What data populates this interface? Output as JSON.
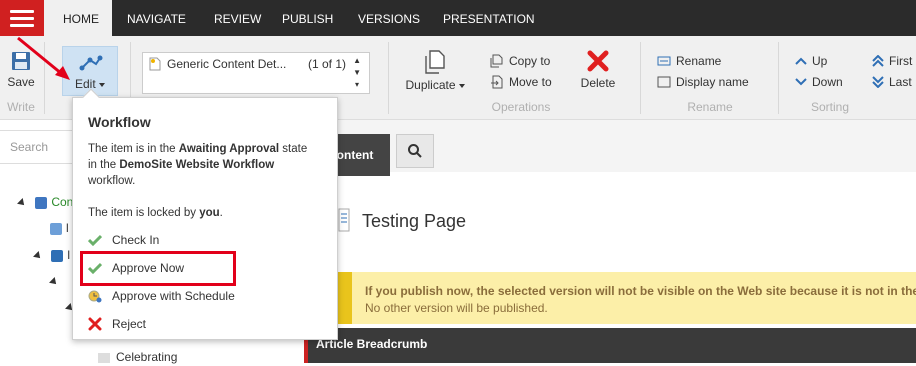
{
  "tabs": [
    "HOME",
    "NAVIGATE",
    "REVIEW",
    "PUBLISH",
    "VERSIONS",
    "PRESENTATION"
  ],
  "ribbon": {
    "save_label": "Save",
    "write_group": "Write",
    "edit_label": "Edit",
    "item_selector_text": "Generic Content Det...",
    "item_selector_count": "(1 of 1)",
    "duplicate_label": "Duplicate",
    "copy_to_label": "Copy to",
    "move_to_label": "Move to",
    "delete_label": "Delete",
    "operations_group": "Operations",
    "rename_label": "Rename",
    "display_name_label": "Display name",
    "rename_group": "Rename",
    "up_label": "Up",
    "down_label": "Down",
    "first_label": "First",
    "last_label": "Last",
    "sorting_group": "Sorting"
  },
  "left_panel": {
    "search_placeholder": "Search",
    "tree_items": [
      "Con",
      "l",
      "l",
      "Celebrating"
    ]
  },
  "content": {
    "tab_label": "Content",
    "page_title": "Testing Page",
    "warning_line1": "If you publish now, the selected version will not be visible on the Web site because it is not in the",
    "warning_line2": "No other version will be published.",
    "breadcrumb_label": "Article Breadcrumb"
  },
  "workflow": {
    "title": "Workflow",
    "state_line1_a": "The item is in the ",
    "state_line1_b": "Awaiting Approval",
    "state_line1_c": " state",
    "state_line2_a": "in the ",
    "state_line2_b": "DemoSite Website Workflow",
    "state_line3": "workflow.",
    "locked_a": "The item is locked by ",
    "locked_b": "you",
    "locked_c": ".",
    "items": [
      "Check In",
      "Approve Now",
      "Approve with Schedule",
      "Reject"
    ]
  },
  "colors": {
    "accent_red": "#d02020",
    "tab_bar": "#2b2b2b",
    "highlight": "#e2001a",
    "warning_bg": "#fcefa8",
    "check_green": "#5cb85c"
  },
  "icons": [
    "hamburger-icon",
    "save-icon",
    "edit-workflow-icon",
    "document-icon",
    "duplicate-icon",
    "copy-icon",
    "move-icon",
    "delete-icon",
    "rename-icon",
    "display-name-icon",
    "up-arrow-icon",
    "down-arrow-icon",
    "first-icon",
    "last-icon",
    "search-icon",
    "check-icon",
    "schedule-icon",
    "reject-icon"
  ]
}
